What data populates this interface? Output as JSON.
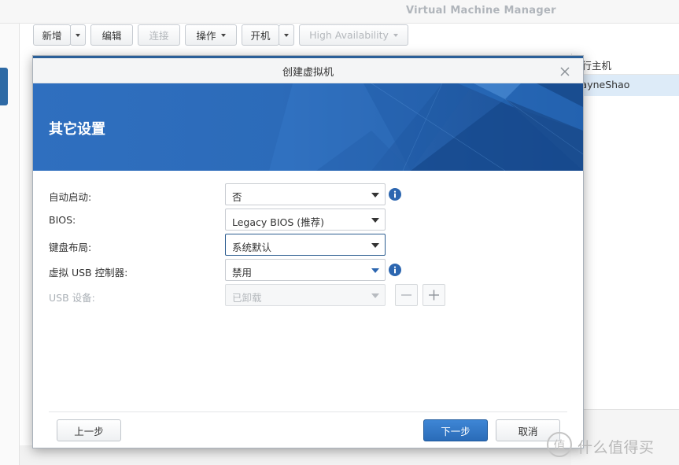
{
  "app": {
    "title": "Virtual Machine Manager",
    "toolbar": {
      "new_label": "新增",
      "edit_label": "编辑",
      "connect_label": "连接",
      "action_label": "操作",
      "power_on_label": "开机",
      "high_availability_label": "High Availability"
    },
    "background_list": {
      "header": "运行主机",
      "selected_row": "WayneShao"
    }
  },
  "dialog": {
    "title": "创建虚拟机",
    "banner_title": "其它设置",
    "fields": [
      {
        "label": "自动启动:",
        "value": "否",
        "info": true,
        "disabled": false
      },
      {
        "label": "BIOS:",
        "value": "Legacy BIOS (推荐)",
        "info": false,
        "disabled": false
      },
      {
        "label": "键盘布局:",
        "value": "系统默认",
        "info": false,
        "disabled": false,
        "focused": true
      },
      {
        "label": "虚拟 USB 控制器:",
        "value": "禁用",
        "info": true,
        "disabled": false
      },
      {
        "label": "USB 设备:",
        "value": "已卸载",
        "info": false,
        "disabled": true
      }
    ],
    "buttons": {
      "back": "上一步",
      "next": "下一步",
      "cancel": "取消"
    }
  },
  "watermark": {
    "logo_text": "值",
    "text": "什么值得买"
  },
  "colors": {
    "banner_blue": "#2a6fbf",
    "primary_button": "#2f73c2",
    "info_icon": "#2c66b0",
    "selected_row": "#ddebf8"
  }
}
